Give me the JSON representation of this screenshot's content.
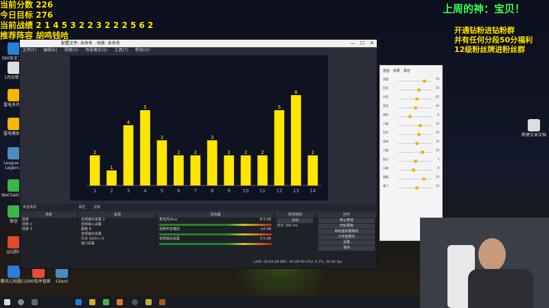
{
  "overlay": {
    "line1": "当前分数 226",
    "line2": "今日目标 276",
    "line3": "当前战绩 2 1 4 5 3 2 2 3 2 2 2 5 6 2",
    "line4": "推荐阵容 胡鸣钱哈"
  },
  "top_right_title": "上周的神：宝贝！",
  "promo": {
    "line1": "开通钻粉进钻粉群",
    "line2": "并有任何分段50分福利",
    "line3": "12级粉丝牌进粉丝群"
  },
  "desktop_icons": [
    {
      "label": "360安全卫士",
      "color": "#2c7fd6"
    },
    {
      "label": "1月份新材",
      "color": "#dddddd"
    },
    {
      "label": "雷电多开器",
      "color": "#f5b800"
    },
    {
      "label": "雷电模拟器",
      "color": "#f5b800"
    },
    {
      "label": "League of Legends",
      "color": "#4a8cc0"
    },
    {
      "label": "WeChatSe...",
      "color": "#3bb54a"
    },
    {
      "label": "微信",
      "color": "#3bb54a"
    },
    {
      "label": "QQ游戏",
      "color": "#e04a2a"
    },
    {
      "label": "腾讯儿科圆(1)",
      "color": "#2c7fd6"
    },
    {
      "label": "360软件管家",
      "color": "#e6493a"
    },
    {
      "label": "Client",
      "color": "#4a8cc0"
    },
    {
      "label": "新建文本文档",
      "color": "#dddddd"
    }
  ],
  "obs": {
    "title": "配置文件: 未命名 - 场景: 未命名",
    "menu": [
      "文件(F)",
      "编辑(E)",
      "视图(V)",
      "场景集合(S)",
      "工具(T)",
      "帮助(H)"
    ],
    "no_source_label": "未选择源",
    "properties_label": "属性",
    "filters_label": "滤镜",
    "docks": {
      "scenes": "场景",
      "sources": "来源",
      "mixer": "混音器",
      "transitions": "转场特效",
      "controls": "控件"
    },
    "scenes": [
      "场景",
      "场景 2",
      "场景 3"
    ],
    "sources": [
      "音频输出采集 2",
      "音频输入采集",
      "图像 8",
      "音频输出采集",
      "文本 (GDI+) 5",
      "窗口采集"
    ],
    "mixer_tracks": [
      "麦克风/Aux",
      "视频声音捕捉",
      "音频输出采集"
    ],
    "mixer_db": [
      "-8.5 dB",
      "-inf dB",
      "0.0 dB"
    ],
    "transition": "淡出",
    "duration_label": "时长",
    "duration_value": "300 ms",
    "controls": [
      "停止推流",
      "开始录制",
      "启动虚拟摄像机",
      "工作室模式",
      "设置",
      "退出"
    ],
    "status": "LIVE: 00:00:00   REC: 00:00:00   CPU: 0.7%, 30.00 fps"
  },
  "mixer_panel": {
    "tabs": [
      "混音",
      "效果",
      "录音"
    ],
    "rows": [
      {
        "label": "音量",
        "level": 0.72,
        "value": "70"
      },
      {
        "label": "低音",
        "level": 0.55,
        "value": "50"
      },
      {
        "label": "中音",
        "level": 0.5,
        "value": "45"
      },
      {
        "label": "高音",
        "level": 0.45,
        "value": "40"
      },
      {
        "label": "增益",
        "level": 0.3,
        "value": "0"
      },
      {
        "label": "小幅",
        "level": 0.6,
        "value": "10"
      },
      {
        "label": "回声",
        "level": 0.55,
        "value": "10"
      },
      {
        "label": "混响",
        "level": 0.5,
        "value": "10"
      },
      {
        "label": "大幅",
        "level": 0.65,
        "value": "10"
      },
      {
        "label": "延迟",
        "level": 0.45,
        "value": "3"
      },
      {
        "label": "压缩",
        "level": 0.4,
        "value": "8"
      },
      {
        "label": "限幅",
        "level": 0.7,
        "value": "10"
      },
      {
        "label": "噪门",
        "level": 0.5,
        "value": "10"
      }
    ]
  },
  "chart_data": {
    "type": "bar",
    "title": "",
    "categories": [
      "1",
      "2",
      "3",
      "4",
      "5",
      "6",
      "7",
      "8",
      "9",
      "10",
      "11",
      "12",
      "13",
      "14"
    ],
    "values": [
      2,
      1,
      4,
      5,
      3,
      2,
      2,
      3,
      2,
      2,
      2,
      5,
      6,
      2
    ],
    "ylim": [
      0,
      8
    ],
    "xlabel": "",
    "ylabel": "",
    "grid": false,
    "legend": "none"
  }
}
